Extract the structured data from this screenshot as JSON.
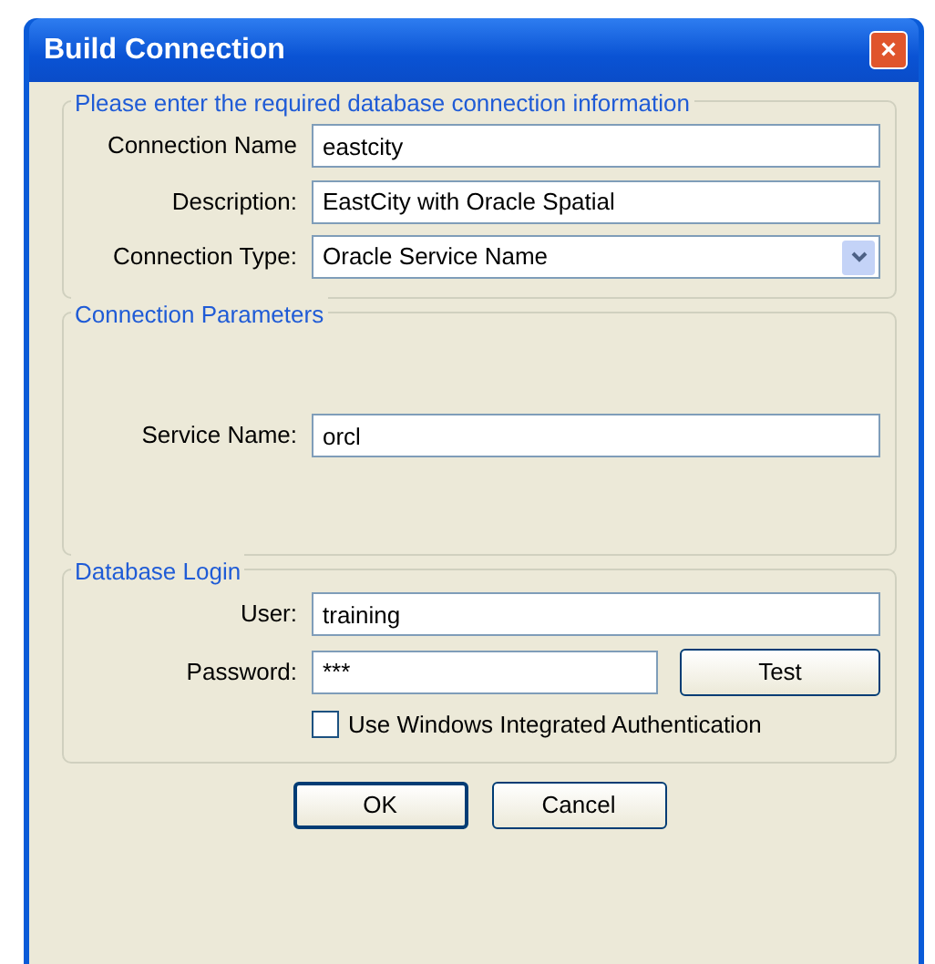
{
  "window": {
    "title": "Build Connection",
    "close": "×"
  },
  "groups": [
    {
      "title": "Please enter the required database connection information",
      "fields": [
        {
          "kind": "text",
          "label": "Connection Name",
          "value": "eastcity"
        },
        {
          "kind": "text",
          "label": "Description:",
          "value": "EastCity with Oracle Spatial"
        },
        {
          "kind": "select",
          "label": "Connection Type:",
          "value": "Oracle Service Name"
        }
      ]
    },
    {
      "title": "Connection Parameters",
      "fields": [
        {
          "kind": "text",
          "label": "Service Name:",
          "value": "orcl"
        }
      ]
    },
    {
      "title": "Database Login",
      "fields": [
        {
          "kind": "text",
          "label": "User:",
          "value": "training"
        },
        {
          "kind": "text_button",
          "label": "Password:",
          "value": "***",
          "button": "Test"
        },
        {
          "kind": "checkbox",
          "label": "Use Windows Integrated Authentication",
          "checked": false
        }
      ]
    }
  ],
  "buttons": [
    "OK",
    "Cancel"
  ]
}
